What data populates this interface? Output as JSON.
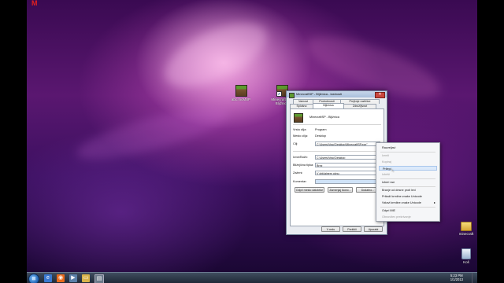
{
  "desktop_icons": {
    "icon1_label": "abc.mcMSP",
    "icon2_label": "MinecraftSP - Bljižnica",
    "folder_label": "minecraft",
    "recycle_label": "Koš"
  },
  "dialog": {
    "title": "MinecraftSP - Bljižnica - lastnosti",
    "close_glyph": "✕",
    "tabs_row1": [
      "Varnost",
      "Podrobnosti",
      "Prejšnje različice"
    ],
    "tabs_row2": [
      "Splošno",
      "Bljižnica",
      "Združljivost"
    ],
    "header_name": "MinecraftSP - Bljižnica",
    "fields": {
      "type_label": "Vrsta cilja:",
      "type_value": "Program",
      "location_label": "Mesto cilja:",
      "location_value": "Desktop",
      "target_label": "Cilj:",
      "target_value": "C:\\Users\\Vrac\\Desktop\\MinecraftSP.exe\"",
      "start_label": "Izvor/Božk:",
      "start_value": "C:\\Users\\Vrac\\Desktop",
      "shortcut_label": "Bližnjična tipka:",
      "shortcut_value": "Brez",
      "run_label": "Zaženi:",
      "run_value": "V običajnem oknu",
      "comment_label": "Komentar:",
      "comment_value": ""
    },
    "buttons": {
      "open_location": "Odpri mesto datoteke",
      "change_icon": "Zamenjaj ikono...",
      "advanced": "Dodatno...",
      "ok": "V redu",
      "cancel": "Prekliči",
      "apply": "Uporabi"
    }
  },
  "context_menu": {
    "items": [
      {
        "label": "Razveljavi",
        "disabled": false
      },
      {
        "label": "Izreži",
        "disabled": true
      },
      {
        "label": "Kopiraj",
        "disabled": true
      },
      {
        "label": "Prilepi",
        "disabled": false,
        "highlighted": true
      },
      {
        "label": "Izbriši",
        "disabled": true
      },
      {
        "label": "Izberi vse",
        "disabled": false
      },
      {
        "label": "Branje od desne proti levi",
        "disabled": false
      },
      {
        "label": "Prikaži krmilne znake Unicode",
        "disabled": false
      },
      {
        "label": "Vstavi krmilne znake Unicode",
        "disabled": false,
        "submenu": true
      },
      {
        "label": "Odpri IME",
        "disabled": false
      },
      {
        "label": "Obnovitev prekrivanje",
        "disabled": true
      }
    ]
  },
  "taskbar": {
    "start_glyph": "⊞",
    "time": "5:23 PM",
    "date": "1/1/2013"
  },
  "colors": {
    "accent": "#1d5fb0",
    "close": "#c9463d",
    "menu_highlight": "#dbe9fa"
  }
}
